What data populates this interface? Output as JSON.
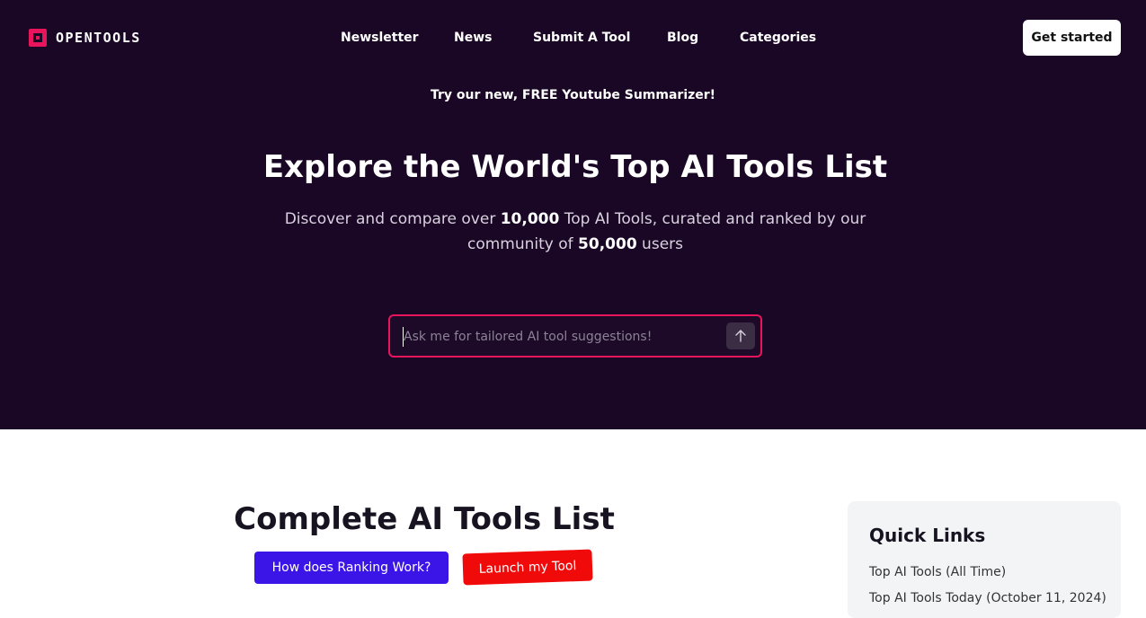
{
  "brand": {
    "name": "OPENTOOLS",
    "accent_color": "#e8155d",
    "hero_bg": "#1a0625"
  },
  "nav": {
    "items": [
      {
        "label": "Newsletter"
      },
      {
        "label": "News"
      },
      {
        "label": "Submit A Tool"
      },
      {
        "label": "Blog"
      },
      {
        "label": "Categories"
      }
    ],
    "cta_label": "Get started"
  },
  "promo": {
    "text": "Try our new, FREE Youtube Summarizer!"
  },
  "hero": {
    "headline": "Explore the World's Top AI Tools List",
    "sub_part1": "Discover and compare over ",
    "sub_count_tools": "10,000",
    "sub_part2": " Top AI Tools, curated and ranked by our community of ",
    "sub_count_users": "50,000",
    "sub_part3": " users"
  },
  "search": {
    "placeholder": "Ask me for tailored AI tool suggestions!",
    "send_icon": "arrow-up-icon"
  },
  "list_section": {
    "title": "Complete AI Tools List",
    "ranking_button": "How does Ranking Work?",
    "launch_button": "Launch my Tool",
    "ranking_color": "#3b14e8",
    "launch_color": "#f00a0a"
  },
  "quick_links": {
    "title": "Quick Links",
    "items": [
      {
        "label": "Top AI Tools (All Time)"
      },
      {
        "label": "Top AI Tools Today (October 11, 2024)"
      }
    ]
  }
}
